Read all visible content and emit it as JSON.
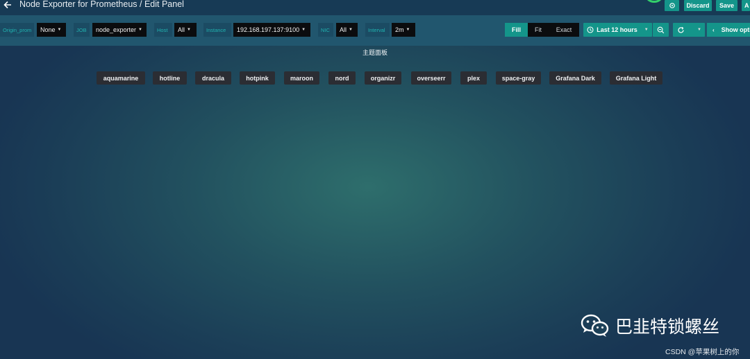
{
  "header": {
    "title": "Node Exporter for Prometheus / Edit Panel",
    "discard_label": "Discard",
    "save_label": "Save",
    "apply_label": "A"
  },
  "variables": [
    {
      "label": "Origin_prom",
      "value": "None"
    },
    {
      "label": "JOB",
      "value": "node_exporter"
    },
    {
      "label": "Host",
      "value": "All"
    },
    {
      "label": "Instance",
      "value": "192.168.197.137:9100"
    },
    {
      "label": "NIC",
      "value": "All"
    },
    {
      "label": "Interval",
      "value": "2m"
    }
  ],
  "size_mode": {
    "options": [
      "Fill",
      "Fit",
      "Exact"
    ],
    "selected": "Fill"
  },
  "time_picker": {
    "label": "Last 12 hours"
  },
  "show_options_label": "Show opti",
  "panel": {
    "title": "主题面板",
    "themes": [
      "aquamarine",
      "hotline",
      "dracula",
      "hotpink",
      "maroon",
      "nord",
      "organizr",
      "overseerr",
      "plex",
      "space-gray",
      "Grafana Dark",
      "Grafana Light"
    ]
  },
  "watermark": {
    "brand": "巴韭特锁螺丝",
    "credit": "CSDN @苹果树上的你"
  },
  "icons": [
    "back-arrow-icon",
    "gear-icon",
    "chevron-down-icon",
    "clock-icon",
    "zoom-out-icon",
    "refresh-icon",
    "chevron-left-icon",
    "wechat-icon"
  ],
  "colors": {
    "accent": "#14958a",
    "label_text": "#20b3b0",
    "topbar": "#173a55",
    "varbar": "#21566e"
  }
}
